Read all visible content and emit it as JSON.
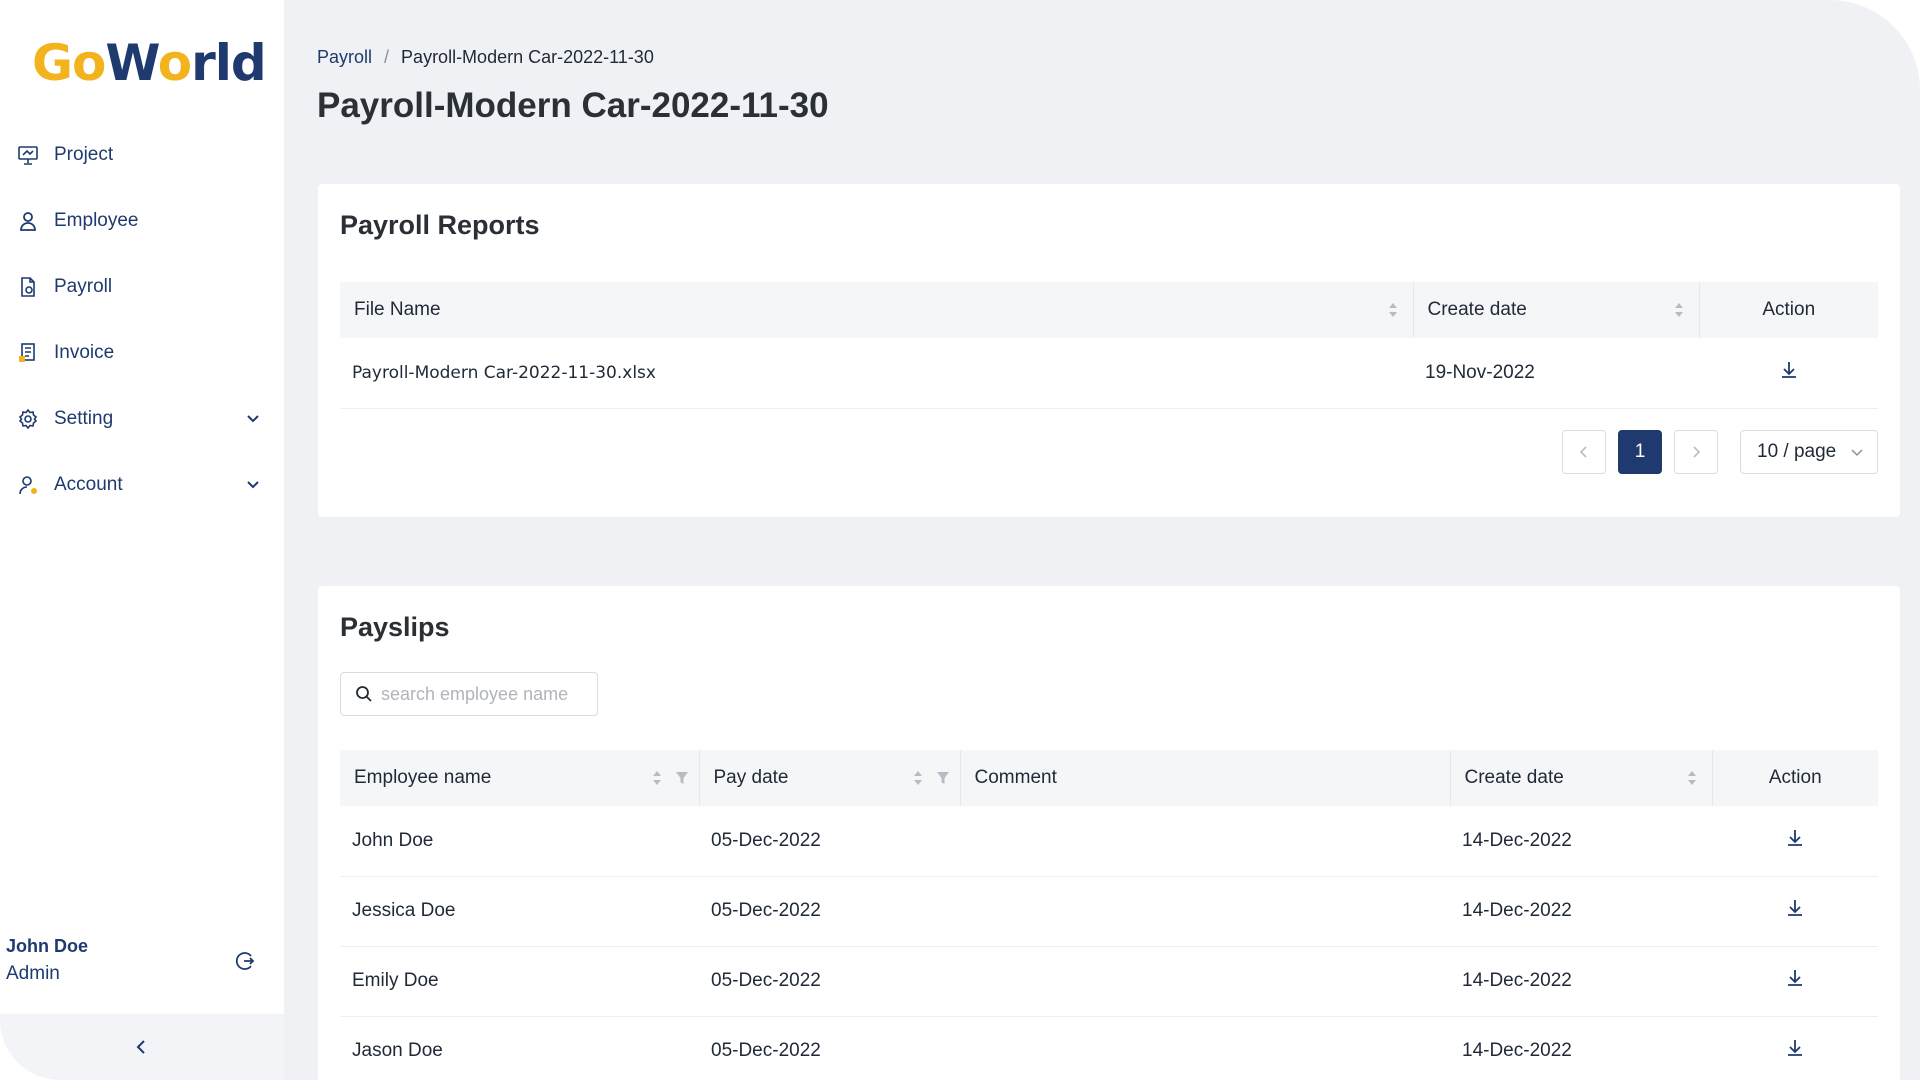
{
  "app": {
    "logo_part1": "Go",
    "logo_part2": "W",
    "logo_part3": "o",
    "logo_part4": "rld"
  },
  "sidebar": {
    "items": [
      {
        "label": "Project"
      },
      {
        "label": "Employee"
      },
      {
        "label": "Payroll"
      },
      {
        "label": "Invoice"
      },
      {
        "label": "Setting"
      },
      {
        "label": "Account"
      }
    ],
    "user": {
      "name": "John Doe",
      "role": "Admin"
    }
  },
  "breadcrumb": {
    "parent": "Payroll",
    "sep": "/",
    "current": "Payroll-Modern Car-2022-11-30"
  },
  "page": {
    "title": "Payroll-Modern Car-2022-11-30"
  },
  "reports": {
    "title": "Payroll Reports",
    "columns": [
      "File Name",
      "Create date",
      "Action"
    ],
    "rows": [
      {
        "file": "Payroll-Modern Car-2022-11-30.xlsx",
        "date": "19-Nov-2022"
      }
    ],
    "pagination": {
      "current": "1",
      "page_size": "10 / page"
    }
  },
  "payslips": {
    "title": "Payslips",
    "search_placeholder": "search employee name",
    "columns": [
      "Employee name",
      "Pay date",
      "Comment",
      "Create date",
      "Action"
    ],
    "rows": [
      {
        "name": "John Doe",
        "pay_date": "05-Dec-2022",
        "comment": "",
        "create_date": "14-Dec-2022"
      },
      {
        "name": "Jessica Doe",
        "pay_date": "05-Dec-2022",
        "comment": "",
        "create_date": "14-Dec-2022"
      },
      {
        "name": "Emily Doe",
        "pay_date": "05-Dec-2022",
        "comment": "",
        "create_date": "14-Dec-2022"
      },
      {
        "name": "Jason Doe",
        "pay_date": "05-Dec-2022",
        "comment": "",
        "create_date": "14-Dec-2022"
      }
    ]
  },
  "colors": {
    "brand_navy": "#1e3a6e",
    "brand_yellow": "#f2b31c",
    "background": "#f0f1f5"
  },
  "icons": [
    "project-icon",
    "employee-icon",
    "payroll-icon",
    "invoice-icon",
    "setting-icon",
    "account-icon",
    "logout-icon",
    "download-icon",
    "search-icon"
  ]
}
